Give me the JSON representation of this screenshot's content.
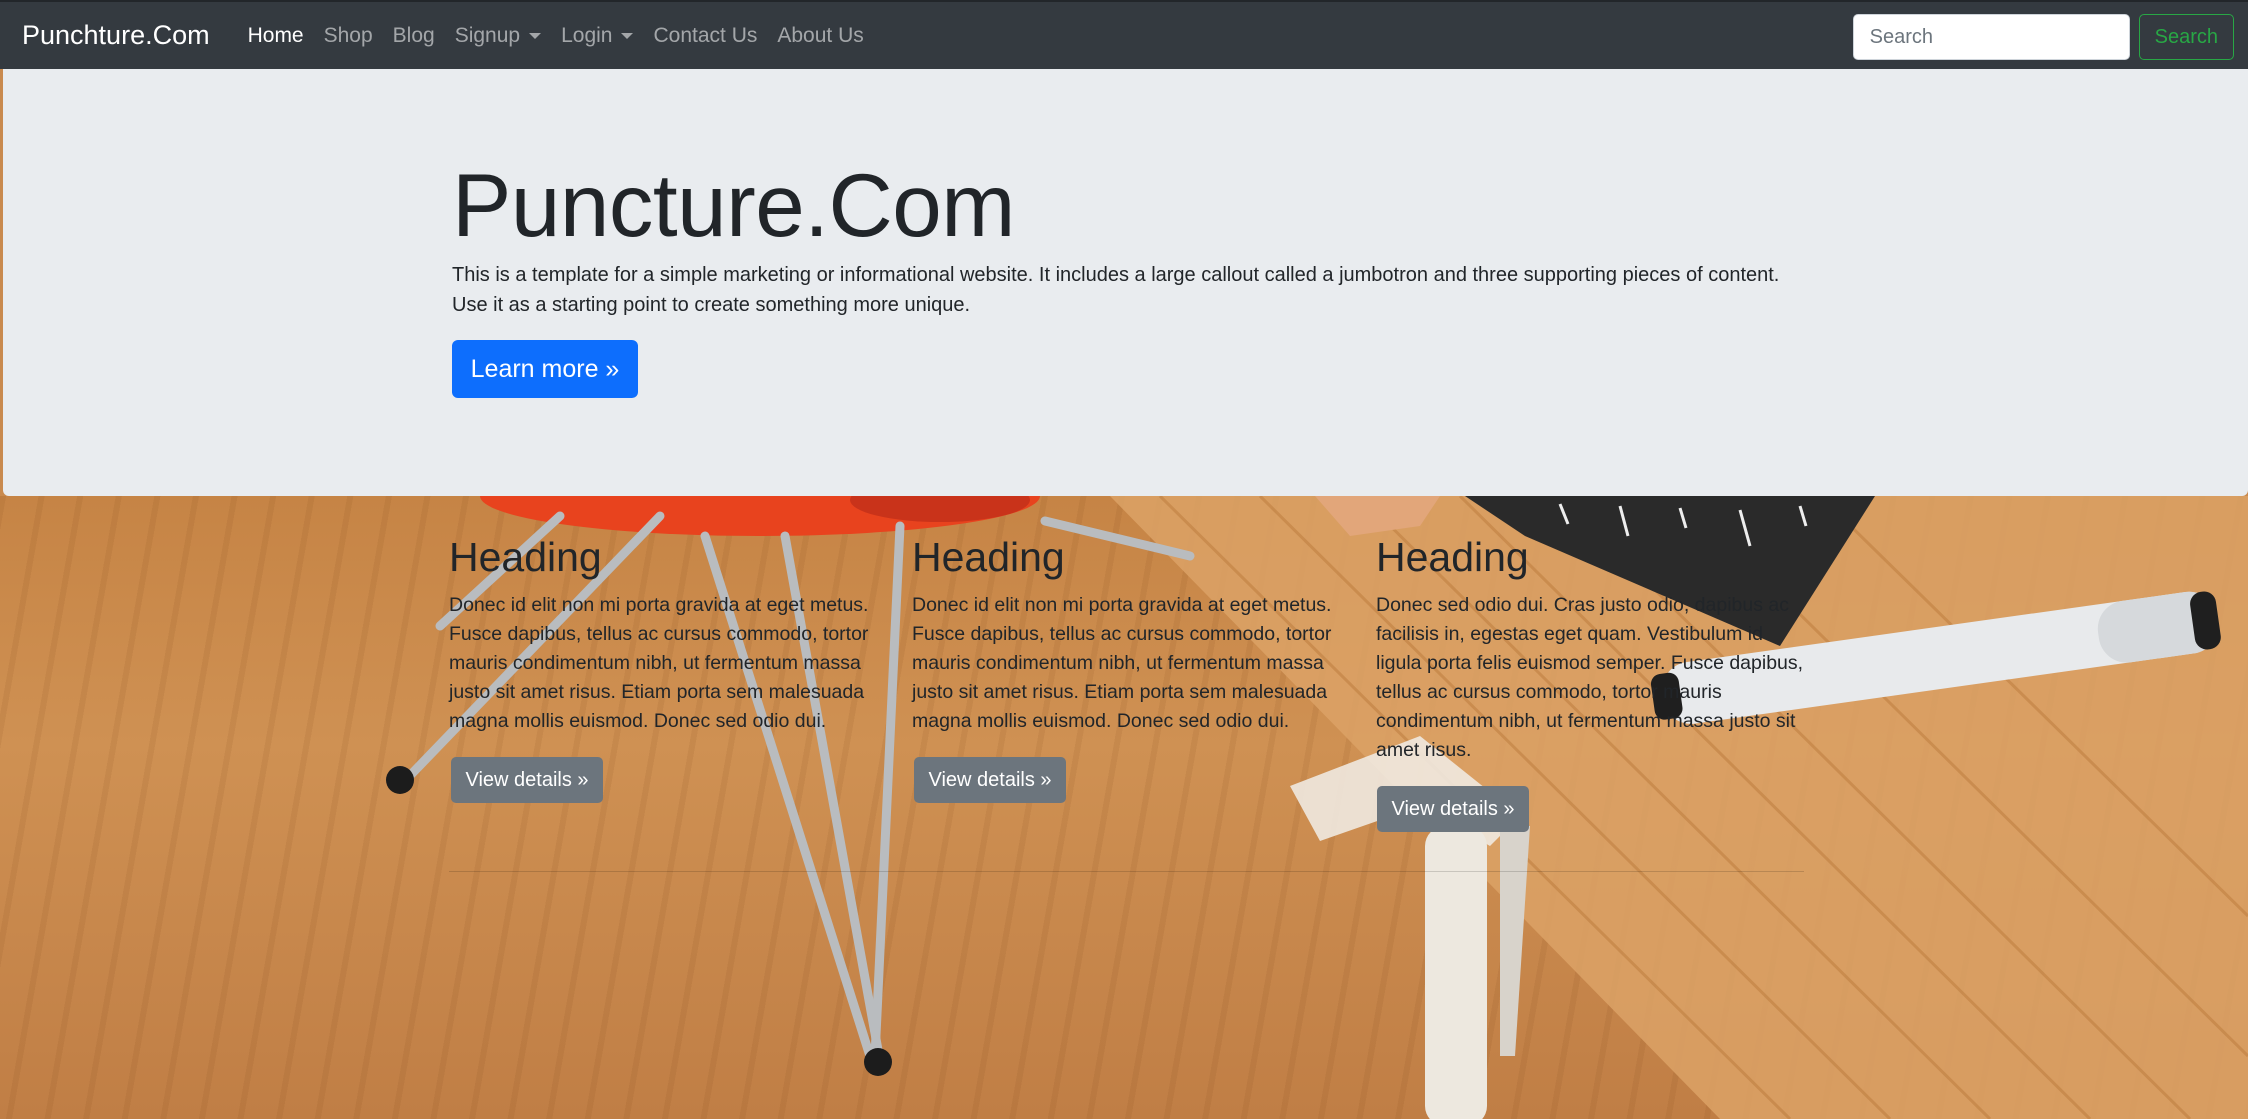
{
  "navbar": {
    "brand": "Punchture.Com",
    "links": [
      {
        "label": "Home",
        "active": true,
        "dropdown": false
      },
      {
        "label": "Shop",
        "active": false,
        "dropdown": false
      },
      {
        "label": "Blog",
        "active": false,
        "dropdown": false
      },
      {
        "label": "Signup",
        "active": false,
        "dropdown": true
      },
      {
        "label": "Login",
        "active": false,
        "dropdown": true
      },
      {
        "label": "Contact Us",
        "active": false,
        "dropdown": false
      },
      {
        "label": "About Us",
        "active": false,
        "dropdown": false
      }
    ],
    "search": {
      "placeholder": "Search",
      "value": "",
      "button_label": "Search"
    }
  },
  "jumbotron": {
    "title": "Puncture.Com",
    "lead": "This is a template for a simple marketing or informational website. It includes a large callout called a jumbotron and three supporting pieces of content. Use it as a starting point to create something more unique.",
    "button_label": "Learn more »"
  },
  "columns": [
    {
      "heading": "Heading",
      "text": "Donec id elit non mi porta gravida at eget metus. Fusce dapibus, tellus ac cursus commodo, tortor mauris condimentum nibh, ut fermentum massa justo sit amet risus. Etiam porta sem malesuada magna mollis euismod. Donec sed odio dui.",
      "button_label": "View details »"
    },
    {
      "heading": "Heading",
      "text": "Donec id elit non mi porta gravida at eget metus. Fusce dapibus, tellus ac cursus commodo, tortor mauris condimentum nibh, ut fermentum massa justo sit amet risus. Etiam porta sem malesuada magna mollis euismod. Donec sed odio dui.",
      "button_label": "View details »"
    },
    {
      "heading": "Heading",
      "text": "Donec sed odio dui. Cras justo odio, dapibus ac facilisis in, egestas eget quam. Vestibulum id ligula porta felis euismod semper. Fusce dapibus, tellus ac cursus commodo, tortor mauris condimentum nibh, ut fermentum massa justo sit amet risus.",
      "button_label": "View details »"
    }
  ],
  "colors": {
    "navbar_bg": "#343a40",
    "jumbotron_bg": "#e9ecef",
    "primary": "#0d6efd",
    "success": "#28a745",
    "secondary": "#6c757d"
  }
}
